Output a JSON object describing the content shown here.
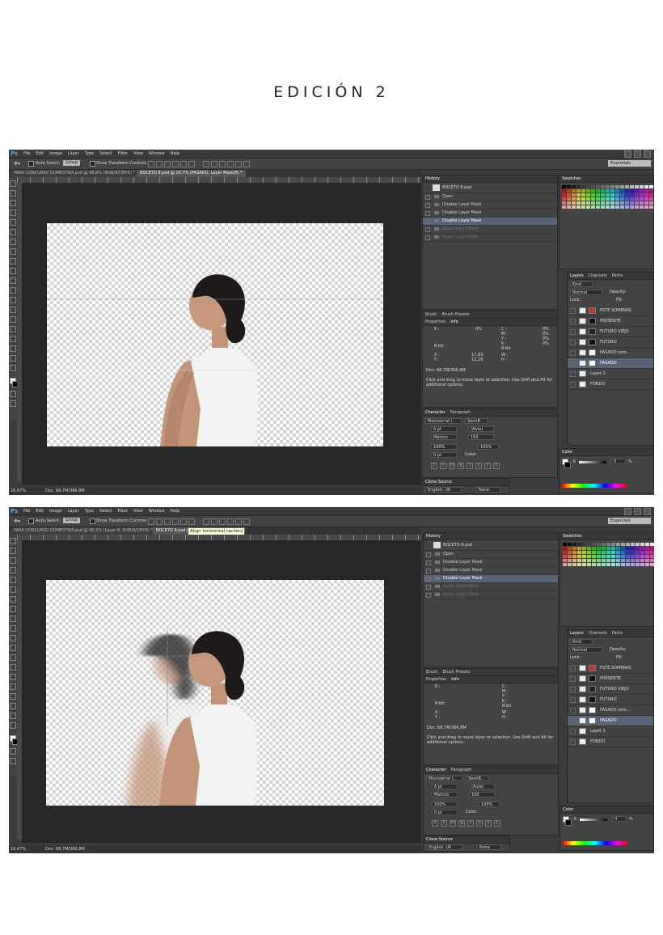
{
  "page_title": "EDICIÓN 2",
  "menu": [
    "File",
    "Edit",
    "Image",
    "Layer",
    "Type",
    "Select",
    "Filter",
    "View",
    "Window",
    "Help"
  ],
  "app_logo": "Ps",
  "options": {
    "auto_select_label": "Auto-Select:",
    "group_value": "Group",
    "transform_label": "Show Transform Controls",
    "workspace": "Essentials"
  },
  "icons": {
    "move": "move-tool-icon",
    "eye": "eye-icon",
    "check": "checkbox-icon"
  },
  "screens": [
    {
      "tabs": [
        "PARA CONCURSO DOMESTIKA.psd @ 48,8% (RGB/8/CMYK)  *",
        "BOCETO 8.psd @ 16,7% (PASADO, Layer Mask/8) *"
      ],
      "tooltip": "",
      "zoom": "16.67%",
      "doc_info": "Doc: 68,7M/366,8M",
      "history": {
        "title": "History",
        "snapshot": "BOCETO 8.psd",
        "items": [
          {
            "label": "Open",
            "state": "normal"
          },
          {
            "label": "Disable Layer Mask",
            "state": "normal"
          },
          {
            "label": "Disable Layer Mask",
            "state": "normal"
          },
          {
            "label": "Disable Layer Mask",
            "state": "selected"
          },
          {
            "label": "Apply Layer Mask",
            "state": "dim"
          },
          {
            "label": "Apply Layer Mask",
            "state": "dim"
          }
        ]
      },
      "info": {
        "tabs": [
          "Brush",
          "Brush Presets"
        ],
        "tabs2": [
          "Properties",
          "Info"
        ],
        "k_label": "K :",
        "k_value": "0%",
        "cmyk": [
          "C :",
          "M :",
          "Y :",
          "K :"
        ],
        "cmyk_values": [
          "0%",
          "0%",
          "0%",
          "0%"
        ],
        "bit1": "8-bit",
        "bit2": "8-bit",
        "xy": [
          "X :",
          "Y :"
        ],
        "xy_values": [
          "17,83",
          "12,29"
        ],
        "wh": [
          "W :",
          "H :"
        ],
        "doc": "Doc: 68,7M/366,8M",
        "hint": "Click and drag to move layer or selection. Use Shift and Alt for additional options."
      },
      "character": {
        "tabs": [
          "Character",
          "Paragraph"
        ],
        "font": "Montserrat (...",
        "style": "SemiB...",
        "size": "6 pt",
        "leading": "(Auto)",
        "kerning": "Metrics",
        "tracking": "150",
        "vscale": "100%",
        "hscale": "100%",
        "baseline": "0 pt",
        "color_label": "Color:"
      },
      "clone": {
        "title": "Clone Source",
        "lang": "English: UK",
        "aa": "None"
      },
      "layers": {
        "tabs": [
          "Layers",
          "Channels",
          "Paths"
        ],
        "kind": "Kind",
        "blend": "Normal",
        "opacity": "Opacity:",
        "lock": "Lock:",
        "fill": "Fill:",
        "items": [
          {
            "name": "PSTE SOMBRAS",
            "sel": false
          },
          {
            "name": "PRESENTE",
            "sel": false
          },
          {
            "name": "FUTURO VIEJO",
            "sel": false
          },
          {
            "name": "FUTURO",
            "sel": false
          },
          {
            "name": "PASADO som...",
            "sel": false
          },
          {
            "name": "PASADO",
            "sel": true
          },
          {
            "name": "Layer 2",
            "sel": false
          },
          {
            "name": "FONDO",
            "sel": false
          }
        ]
      },
      "swatches_title": "Swatches",
      "color_title": "Color",
      "color_k": "K",
      "color_val": "0",
      "color_pct": "%"
    },
    {
      "tabs": [
        "PARA CONCURSO DOMESTIKA.psd @ 40,3% (Layer 8, RGB/8/CMYK) *",
        "BOCETO 8.psd @"
      ],
      "tooltip": "Align horizontal centers",
      "zoom": "16.67%",
      "doc_info": "Doc: 68,7M/366,8M",
      "history": {
        "title": "History",
        "snapshot": "BOCETO 8.psd",
        "items": [
          {
            "label": "Open",
            "state": "normal"
          },
          {
            "label": "Disable Layer Mask",
            "state": "normal"
          },
          {
            "label": "Disable Layer Mask",
            "state": "normal"
          },
          {
            "label": "Disable Layer Mask",
            "state": "selected"
          },
          {
            "label": "Apply Layer Mask",
            "state": "dim"
          },
          {
            "label": "Apply Layer Mask",
            "state": "dim"
          }
        ]
      },
      "info": {
        "tabs": [
          "Brush",
          "Brush Presets"
        ],
        "tabs2": [
          "Properties",
          "Info"
        ],
        "k_label": "K :",
        "k_value": "",
        "cmyk": [
          "C :",
          "M :",
          "Y :",
          "K :"
        ],
        "cmyk_values": [
          "",
          "",
          "",
          ""
        ],
        "bit1": "8-bit",
        "bit2": "8-bit",
        "xy": [
          "X :",
          "Y :"
        ],
        "xy_values": [
          "",
          ""
        ],
        "wh": [
          "W :",
          "H :"
        ],
        "doc": "Doc: 68,7M/366,8M",
        "hint": "Click and drag to move layer or selection. Use Shift and Alt for additional options."
      },
      "character": {
        "tabs": [
          "Character",
          "Paragraph"
        ],
        "font": "Montserrat (...",
        "style": "SemiB...",
        "size": "6 pt",
        "leading": "(Auto)",
        "kerning": "Metrics",
        "tracking": "150",
        "vscale": "100%",
        "hscale": "100%",
        "baseline": "0 pt",
        "color_label": "Color:"
      },
      "clone": {
        "title": "Clone Source",
        "lang": "English: UK",
        "aa": "None"
      },
      "layers": {
        "tabs": [
          "Layers",
          "Channels",
          "Paths"
        ],
        "kind": "Kind",
        "blend": "Normal",
        "opacity": "Opacity:",
        "lock": "Lock:",
        "fill": "Fill:",
        "items": [
          {
            "name": "PSTE SOMBRAS",
            "sel": false
          },
          {
            "name": "PRESENTE",
            "sel": false
          },
          {
            "name": "FUTURO VIEJO",
            "sel": false
          },
          {
            "name": "FUTURO",
            "sel": false
          },
          {
            "name": "PASADO som...",
            "sel": false
          },
          {
            "name": "PASADO",
            "sel": true
          },
          {
            "name": "Layer 2",
            "sel": false
          },
          {
            "name": "FONDO",
            "sel": false
          }
        ]
      },
      "swatches_title": "Swatches",
      "color_title": "Color",
      "color_k": "K",
      "color_val": "0",
      "color_pct": "%"
    }
  ]
}
